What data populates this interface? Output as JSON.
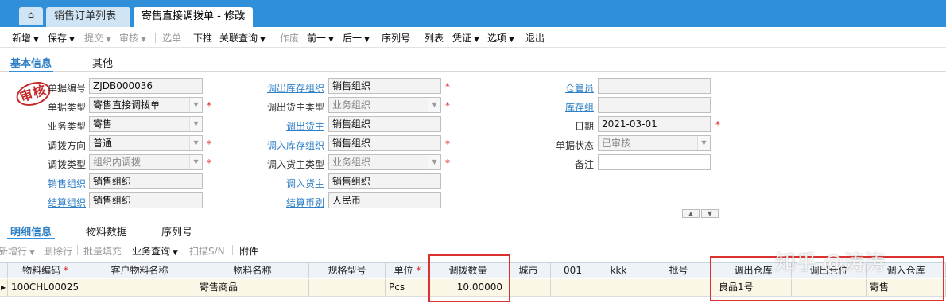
{
  "tabs": {
    "home_icon": "home-icon",
    "items": [
      {
        "label": "销售订单列表",
        "active": false
      },
      {
        "label": "寄售直接调拨单 - 修改",
        "active": true
      }
    ],
    "close_glyph": "×"
  },
  "toolbar": {
    "items": [
      {
        "label": "新增",
        "caret": true,
        "enabled": true
      },
      {
        "label": "保存",
        "caret": true,
        "enabled": true
      },
      {
        "label": "提交",
        "caret": true,
        "enabled": false
      },
      {
        "label": "审核",
        "caret": true,
        "enabled": false
      },
      {
        "label": "选单",
        "caret": false,
        "enabled": false
      },
      {
        "label": "下推",
        "caret": false,
        "enabled": true
      },
      {
        "label": "关联查询",
        "caret": true,
        "enabled": true
      },
      {
        "label": "作废",
        "caret": false,
        "enabled": false
      },
      {
        "label": "前一",
        "caret": true,
        "enabled": true
      },
      {
        "label": "后一",
        "caret": true,
        "enabled": true
      },
      {
        "label": "序列号",
        "caret": false,
        "enabled": true
      },
      {
        "label": "列表",
        "caret": false,
        "enabled": true
      },
      {
        "label": "凭证",
        "caret": true,
        "enabled": true
      },
      {
        "label": "选项",
        "caret": true,
        "enabled": true
      },
      {
        "label": "退出",
        "caret": false,
        "enabled": true
      }
    ]
  },
  "form_tabs": [
    {
      "label": "基本信息",
      "active": true
    },
    {
      "label": "其他",
      "active": false
    }
  ],
  "stamp": "审核",
  "fields": {
    "bill_no": {
      "label": "单据编号",
      "value": "ZJDB000036"
    },
    "bill_type": {
      "label": "单据类型",
      "value": "寄售直接调拨单"
    },
    "biz_type": {
      "label": "业务类型",
      "value": "寄售"
    },
    "transfer_direction": {
      "label": "调拨方向",
      "value": "普通"
    },
    "transfer_type": {
      "label": "调拨类型",
      "value": "组织内调拨"
    },
    "sale_org": {
      "label": "销售组织",
      "value": "销售组织"
    },
    "settle_org": {
      "label": "结算组织",
      "value": "销售组织"
    },
    "out_stock_org": {
      "label": "调出库存组织",
      "value": "销售组织"
    },
    "out_owner_type": {
      "label": "调出货主类型",
      "value": "业务组织"
    },
    "out_owner": {
      "label": "调出货主",
      "value": "销售组织"
    },
    "in_stock_org": {
      "label": "调入库存组织",
      "value": "销售组织"
    },
    "in_owner_type": {
      "label": "调入货主类型",
      "value": "业务组织"
    },
    "in_owner": {
      "label": "调入货主",
      "value": "销售组织"
    },
    "settle_currency": {
      "label": "结算币别",
      "value": "人民币"
    },
    "keeper": {
      "label": "仓管员",
      "value": ""
    },
    "stock_group": {
      "label": "库存组",
      "value": ""
    },
    "date": {
      "label": "日期",
      "value": "2021-03-01"
    },
    "bill_status": {
      "label": "单据状态",
      "value": "已审核"
    },
    "remark": {
      "label": "备注",
      "value": ""
    }
  },
  "detail_tabs": [
    {
      "label": "明细信息",
      "active": true
    },
    {
      "label": "物料数据",
      "active": false
    },
    {
      "label": "序列号",
      "active": false
    }
  ],
  "grid_toolbar": [
    {
      "label": "新增行",
      "caret": true,
      "enabled": false
    },
    {
      "label": "删除行",
      "caret": false,
      "enabled": false
    },
    {
      "label": "批量填充",
      "caret": false,
      "enabled": false
    },
    {
      "label": "业务查询",
      "caret": true,
      "enabled": true
    },
    {
      "label": "扫描S/N",
      "caret": false,
      "enabled": false
    },
    {
      "label": "附件",
      "caret": false,
      "enabled": true
    }
  ],
  "grid": {
    "columns": [
      "物料编码",
      "客户物料名称",
      "物料名称",
      "规格型号",
      "单位",
      "调拨数量",
      "城市",
      "001",
      "kkk",
      "批号",
      "调出仓库",
      "调出仓位",
      "调入仓库"
    ],
    "required_columns": [
      "物料编码",
      "单位"
    ],
    "rows": [
      [
        "100CHL00025",
        "",
        "寄售商品",
        "",
        "Pcs",
        "10.00000",
        "",
        "",
        "",
        "",
        "良品1号",
        "",
        "寄售"
      ]
    ]
  },
  "watermark": "知乎 @涛涛",
  "colors": {
    "accent": "#2f8fd8",
    "required": "#d22222",
    "highlight_box": "#d9322f",
    "stamp": "#c52a2a"
  }
}
